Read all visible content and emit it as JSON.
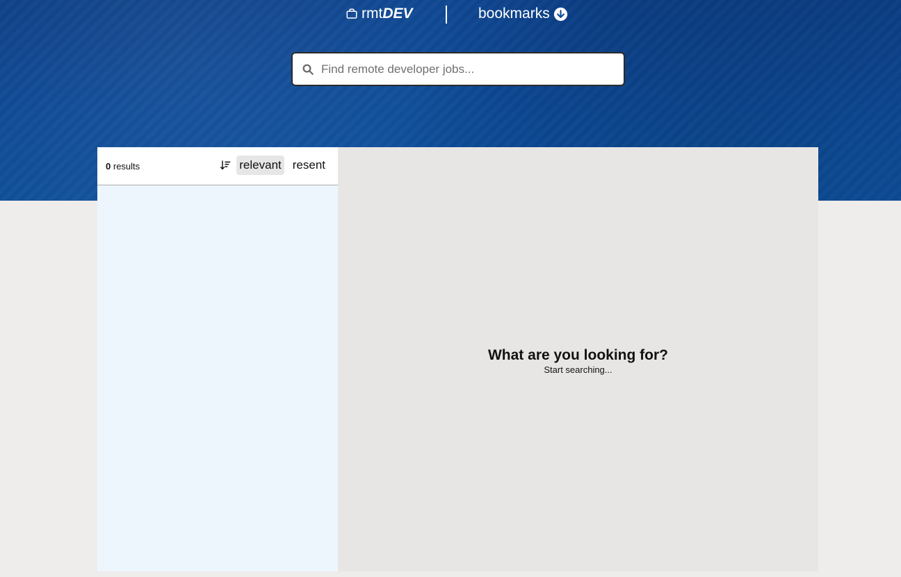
{
  "header": {
    "logo_prefix": "rmt",
    "logo_bold": "DEV",
    "bookmarks_label": "bookmarks"
  },
  "search": {
    "placeholder": "Find remote developer jobs...",
    "value": ""
  },
  "sidebar": {
    "results_count": "0",
    "results_label": "results",
    "sort_options": [
      "relevant",
      "resent"
    ],
    "active_sort": "relevant"
  },
  "details": {
    "empty_title": "What are you looking for?",
    "empty_subtitle": "Start searching..."
  },
  "colors": {
    "hero": "#0c4893",
    "sidebar_bg": "#eef6fd",
    "details_bg": "#e8e6e4",
    "page_bg": "#efecec"
  },
  "icons": {
    "logo": "briefcase-icon",
    "bookmarks": "arrow-down-circle-icon",
    "search": "search-icon",
    "sort": "sort-descending-icon"
  }
}
